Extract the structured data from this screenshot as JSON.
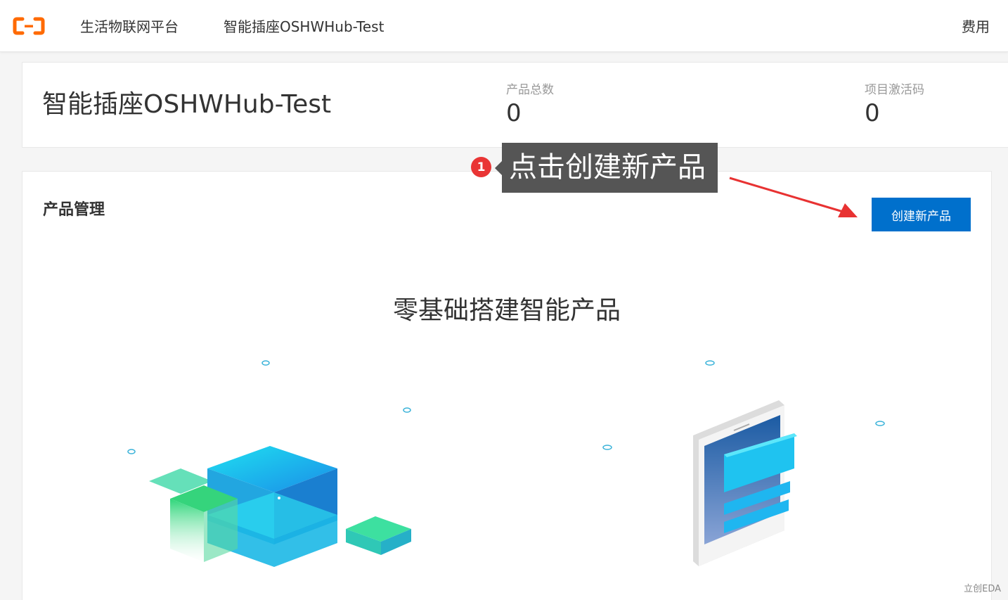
{
  "topbar": {
    "logo_icon": "aliyun-logo-icon",
    "platform_label": "生活物联网平台",
    "project_label": "智能插座OSHWHub-Test",
    "billing_label": "费用"
  },
  "summary": {
    "project_title": "智能插座OSHWHub-Test",
    "stats": [
      {
        "label": "产品总数",
        "value": "0"
      },
      {
        "label": "项目激活码",
        "value": "0"
      }
    ]
  },
  "product_management": {
    "section_title": "产品管理",
    "create_button_label": "创建新产品",
    "hero_title": "零基础搭建智能产品"
  },
  "annotation": {
    "step_number": "1",
    "tooltip_text": "点击创建新产品",
    "arrow_color": "#e83232"
  },
  "watermark": "立创EDA",
  "colors": {
    "brand_orange": "#ff6a00",
    "primary_blue": "#0070cc",
    "badge_red": "#e93535"
  }
}
